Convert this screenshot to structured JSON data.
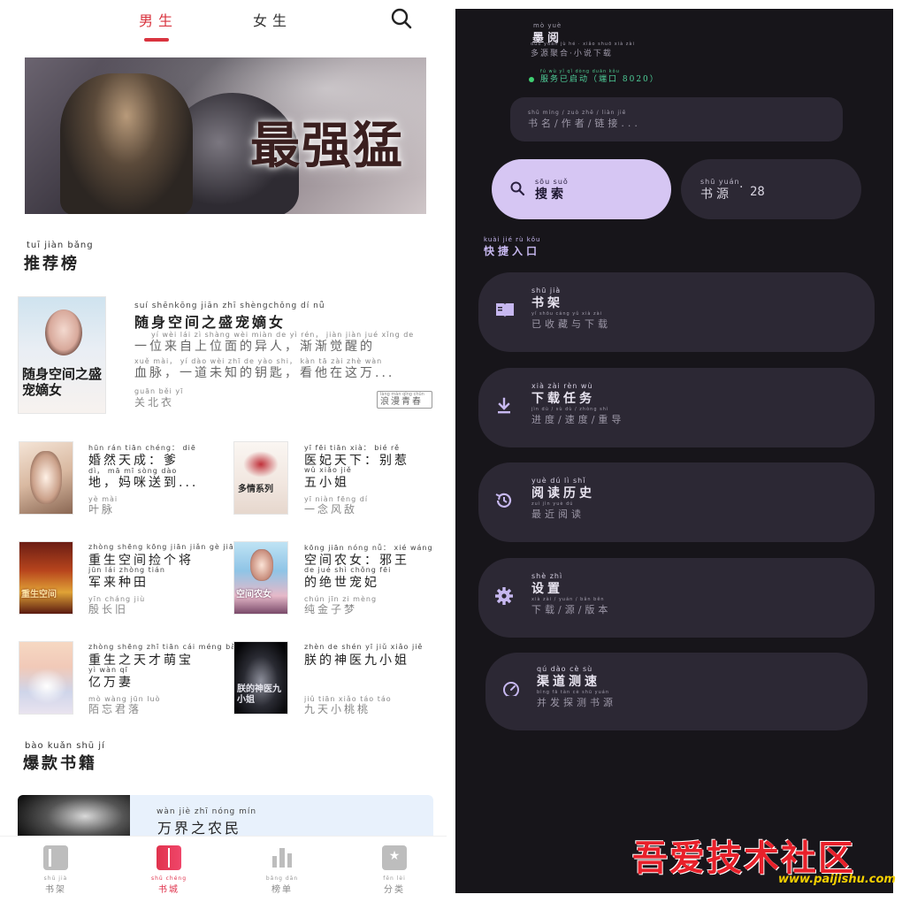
{
  "left": {
    "tabs": [
      {
        "label": "男生",
        "active": true
      },
      {
        "label": "女生",
        "active": false
      }
    ],
    "search_icon": "search-icon",
    "banner": {
      "art_text": "最强猛"
    },
    "sections": {
      "recommend": {
        "pinyin": "tuī jiàn bǎng",
        "title": "推荐榜"
      },
      "hot": {
        "pinyin": "bào kuǎn shū jí",
        "title": "爆款书籍"
      }
    },
    "featured": {
      "title_pinyin": "suí shēnkōng jiān zhī shèngchǒng dí nǚ",
      "title": "随身空间之盛宠嫡女",
      "desc_pinyin_1": "yí wèi lái zì shàng wèi miàn de yì rén， jiàn jiàn jué xǐng de",
      "desc_1": "一位来自上位面的异人，渐渐觉醒的",
      "desc_pinyin_2": "xuě mài， yí dào wèi zhī de yào shi， kàn tā zài zhè wàn",
      "desc_2": "血脉，一道未知的钥匙，看他在这万...",
      "author_pinyin": "guān běi yī",
      "author": "关北衣",
      "genre_pinyin": "làng màn qīng chūn",
      "genre": "浪漫青春",
      "cover_text": "随身空间之盛宠嫡女"
    },
    "grid": [
      {
        "title_pinyin": "hūn rán tiān chéng： diē",
        "title": "婚然天成：爹",
        "title2_pinyin": "dì， mā mī sòng dào",
        "title2": "地，妈咪送到...",
        "author_pinyin": "yè mài",
        "author": "叶脉"
      },
      {
        "title_pinyin": "yī fēi tiān xià： bié rě",
        "title": "医妃天下：别惹",
        "title2_pinyin": "wǔ xiǎo jiě",
        "title2": "五小姐",
        "author_pinyin": "yī niàn fēng dí",
        "author": "一念风敌"
      },
      {
        "title_pinyin": "zhòng shēng kōng jiān jiǎn gè jiāng",
        "title": "重生空间捡个将",
        "title2_pinyin": "jūn lái zhòng tián",
        "title2": "军来种田",
        "author_pinyin": "yīn cháng jiù",
        "author": "殷长旧"
      },
      {
        "title_pinyin": "kōng jiān nóng nǚ： xié wáng",
        "title": "空间农女：邪王",
        "title2_pinyin": "de jué shì chǒng fēi",
        "title2": "的绝世宠妃",
        "author_pinyin": "chún jīn zi mèng",
        "author": "纯金子梦"
      },
      {
        "title_pinyin": "zhòng shēng zhī tiān cái méng bǎo",
        "title": "重生之天才萌宝",
        "title2_pinyin": "yì wàn qī",
        "title2": "亿万妻",
        "author_pinyin": "mò wàng jūn luò",
        "author": "陌忘君落"
      },
      {
        "title_pinyin": "zhèn de shén yī jiǔ xiǎo jiě",
        "title": "朕的神医九小姐",
        "title2_pinyin": "",
        "title2": "",
        "author_pinyin": "jiǔ tiān xiǎo táo táo",
        "author": "九天小桃桃"
      }
    ],
    "grid_covers": [
      "",
      "多情系列",
      "重生空间",
      "空间农女",
      "",
      "朕的神医九小姐"
    ],
    "hot_item": {
      "title_pinyin": "wàn jiè zhī nóng mín",
      "title": "万界之农民"
    },
    "nav": [
      {
        "pinyin": "shū jià",
        "label": "书架",
        "icon": "book-icon",
        "active": false
      },
      {
        "pinyin": "shū chéng",
        "label": "书城",
        "icon": "open-book-icon",
        "active": true
      },
      {
        "pinyin": "bǎng dān",
        "label": "榜单",
        "icon": "bar-chart-icon",
        "active": false
      },
      {
        "pinyin": "fēn lèi",
        "label": "分类",
        "icon": "star-bookmark-icon",
        "active": false
      }
    ]
  },
  "right": {
    "app_pinyin": "mò yuè",
    "app_name": "墨阅",
    "tagline_pinyin": "duō yuán jù hé · xiǎo shuō xià zài",
    "tagline": "多源聚合·小说下载",
    "status_pinyin": "fú wù yǐ qǐ dòng duān kǒu",
    "status": "服务已启动（端口 8020）",
    "search_placeholder_pinyin": "shū míng / zuò zhě / liàn jiē",
    "search_placeholder": "书名/作者/链接...",
    "search_button_pinyin": "sōu suǒ",
    "search_button": "搜索",
    "source_pinyin": "shū yuán",
    "source_label": "书源",
    "source_count": "28",
    "quick_pinyin": "kuài jié rù kǒu",
    "quick_title": "快捷入口",
    "cards": [
      {
        "icon": "bookshelf-icon",
        "title_pinyin": "shū jià",
        "title": "书架",
        "sub_pinyin": "yǐ shōu cáng yǔ xià zài",
        "sub": "已收藏与下载"
      },
      {
        "icon": "download-icon",
        "title_pinyin": "xià zài rèn wù",
        "title": "下载任务",
        "sub_pinyin": "jìn dù / sù dù / zhòng shì",
        "sub": "进度/速度/重导"
      },
      {
        "icon": "history-icon",
        "title_pinyin": "yuè dú lì shǐ",
        "title": "阅读历史",
        "sub_pinyin": "zuì jìn yuè dú",
        "sub": "最近阅读"
      },
      {
        "icon": "settings-gear-icon",
        "title_pinyin": "shè zhì",
        "title": "设置",
        "sub_pinyin": "xià zài / yuán / bǎn běn",
        "sub": "下载/源/版本"
      },
      {
        "icon": "speedometer-icon",
        "title_pinyin": "qú dào cè sù",
        "title": "渠道测速",
        "sub_pinyin": "bìng fā tàn cè shū yuán",
        "sub": "并发探测书源"
      }
    ],
    "status_color": "#3fcf72",
    "accent": "#d6c6f3"
  },
  "watermark": {
    "text": "吾爱技术社区",
    "url": "www.paijishu.com"
  }
}
